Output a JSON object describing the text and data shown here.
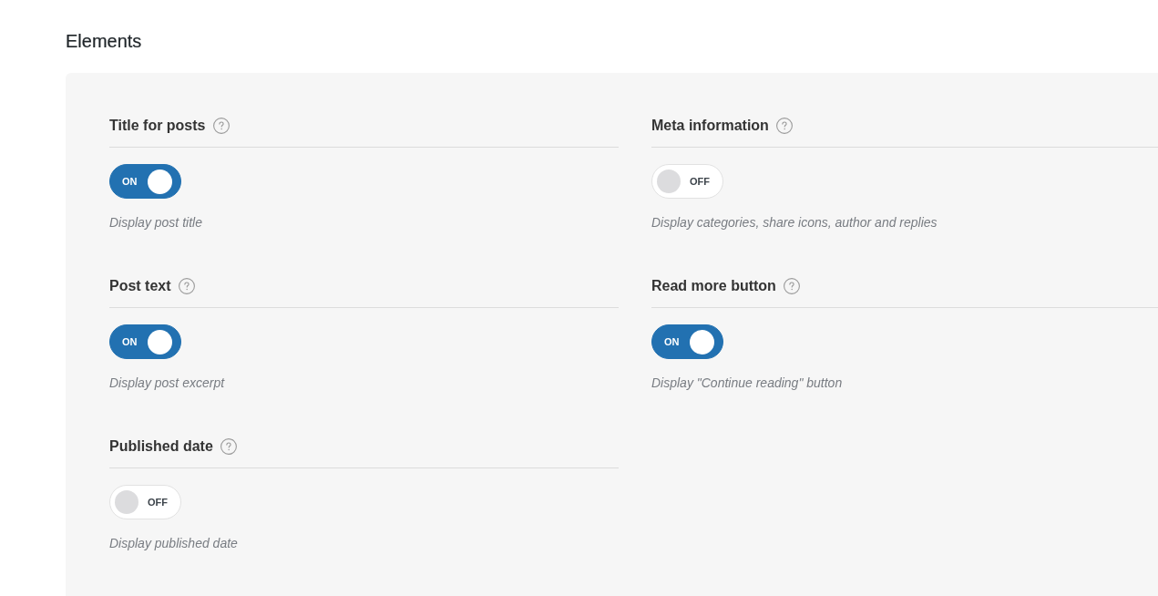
{
  "section": {
    "title": "Elements"
  },
  "settings": [
    {
      "label": "Title for posts",
      "on": true,
      "toggle_text": "ON",
      "description": "Display post title"
    },
    {
      "label": "Meta information",
      "on": false,
      "toggle_text": "OFF",
      "description": "Display categories, share icons, author and replies"
    },
    {
      "label": "Post text",
      "on": true,
      "toggle_text": "ON",
      "description": "Display post excerpt"
    },
    {
      "label": "Read more button",
      "on": true,
      "toggle_text": "ON",
      "description": "Display \"Continue reading\" button"
    },
    {
      "label": "Published date",
      "on": false,
      "toggle_text": "OFF",
      "description": "Display published date"
    }
  ]
}
